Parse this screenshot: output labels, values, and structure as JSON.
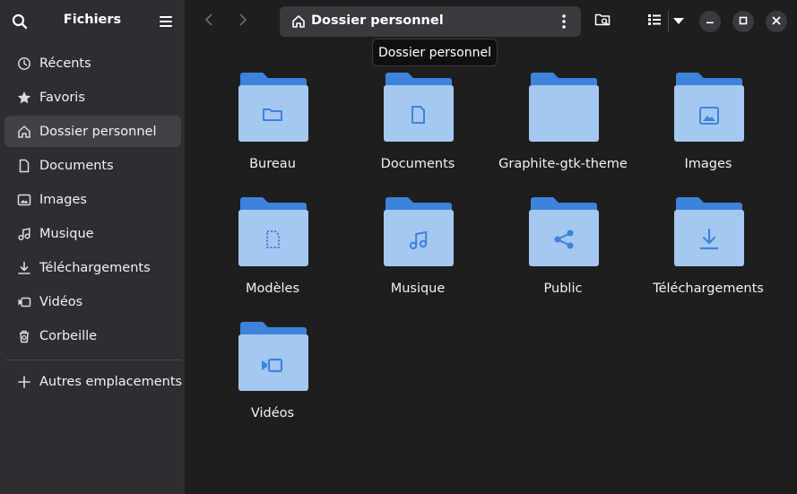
{
  "sidebar": {
    "title": "Fichiers",
    "items": [
      {
        "label": "Récents",
        "icon": "clock-icon"
      },
      {
        "label": "Favoris",
        "icon": "star-icon"
      },
      {
        "label": "Dossier personnel",
        "icon": "home-icon",
        "active": true
      },
      {
        "label": "Documents",
        "icon": "document-icon"
      },
      {
        "label": "Images",
        "icon": "image-icon"
      },
      {
        "label": "Musique",
        "icon": "music-icon"
      },
      {
        "label": "Téléchargements",
        "icon": "download-icon"
      },
      {
        "label": "Vidéos",
        "icon": "video-icon"
      },
      {
        "label": "Corbeille",
        "icon": "trash-icon"
      }
    ],
    "other_locations": {
      "label": "Autres emplacements",
      "icon": "plus-icon"
    }
  },
  "header": {
    "path_label": "Dossier personnel",
    "tooltip": "Dossier personnel"
  },
  "folders": [
    {
      "label": "Bureau",
      "icon": "folder-desktop-icon"
    },
    {
      "label": "Documents",
      "icon": "folder-documents-icon"
    },
    {
      "label": "Graphite-gtk-theme",
      "icon": "folder-icon"
    },
    {
      "label": "Images",
      "icon": "folder-pictures-icon"
    },
    {
      "label": "Modèles",
      "icon": "folder-templates-icon"
    },
    {
      "label": "Musique",
      "icon": "folder-music-icon"
    },
    {
      "label": "Public",
      "icon": "folder-publicshare-icon"
    },
    {
      "label": "Téléchargements",
      "icon": "folder-download-icon"
    },
    {
      "label": "Vidéos",
      "icon": "folder-videos-icon"
    }
  ],
  "colors": {
    "folder_back": "#3d83dc",
    "folder_front": "#a4c8f0",
    "folder_emblem": "#3d83dc",
    "sidebar_bg": "#2e2e32",
    "main_bg": "#1e1e1e"
  }
}
